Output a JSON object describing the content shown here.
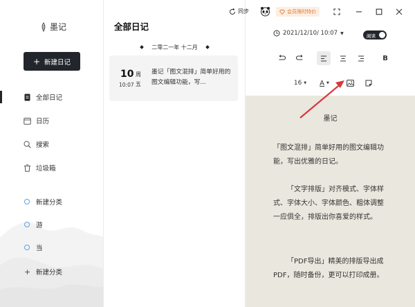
{
  "sidebar": {
    "logo_text": "墨记",
    "new_diary_label": "新建日记",
    "nav": [
      {
        "label": "全部日记",
        "icon": "note-icon"
      },
      {
        "label": "日历",
        "icon": "calendar-icon"
      },
      {
        "label": "搜索",
        "icon": "search-icon"
      },
      {
        "label": "垃圾箱",
        "icon": "trash-icon"
      }
    ],
    "categories": [
      {
        "label": "新建分类"
      },
      {
        "label": "游"
      },
      {
        "label": "当"
      }
    ],
    "add_category_label": "新建分类"
  },
  "list": {
    "title": "全部日记",
    "group_date": "二零二一年 十二月",
    "entries": [
      {
        "day": "10",
        "weekday": "周五",
        "time": "10:07",
        "text": "墨记「图文混排」简单好用的图文编辑功能，写..."
      }
    ]
  },
  "titlebar": {
    "sync_label": "同步",
    "vip_label": "会员限时特价"
  },
  "editor": {
    "datetime": "2021/12/10/ 10:07",
    "read_label": "阅读",
    "font_size": "16",
    "font_color_label": "A",
    "bold_label": "B",
    "content": {
      "title": "墨记",
      "paragraphs": [
        "「图文混排」简单好用的图文编辑功能，写出优雅的日记。",
        "「文字排版」对齐模式、字体样式、字体大小、字体颜色、粗体调整一应俱全，排版出你喜爱的样式。",
        "「PDF导出」精美的排版导出成PDF，随时备份，更可以打印成册。"
      ]
    }
  },
  "colors": {
    "accent_dark": "#22252b",
    "paper_bg": "#eae7de",
    "vip_orange": "#e07a36",
    "category_dot": "#5aa0e6",
    "annotation_arrow": "#d9363e"
  }
}
